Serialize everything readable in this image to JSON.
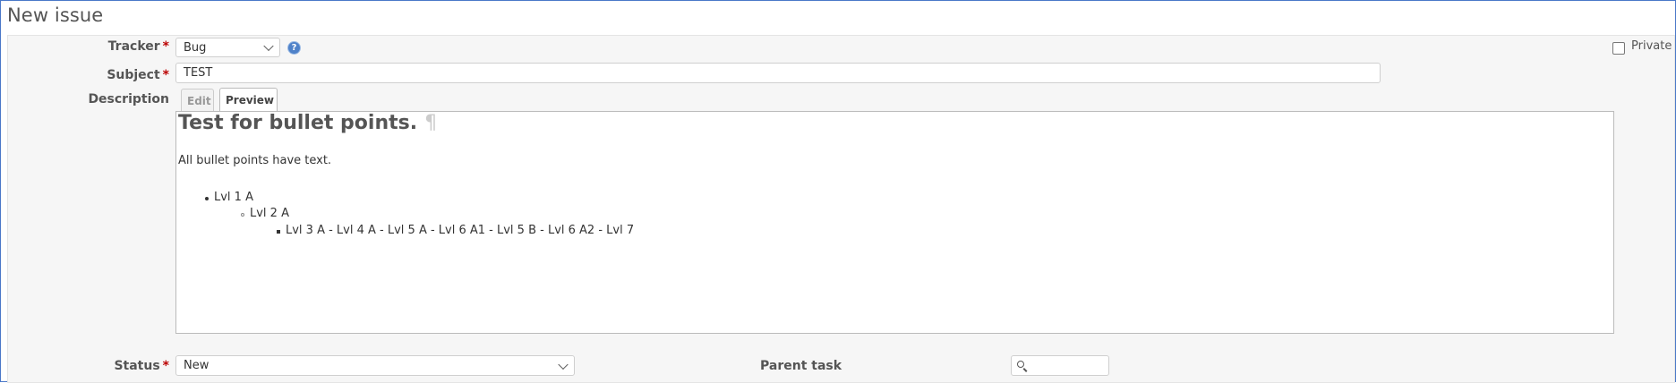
{
  "page": {
    "title": "New issue"
  },
  "tracker": {
    "label": "Tracker",
    "required": "*",
    "value": "Bug"
  },
  "private": {
    "label": "Private"
  },
  "subject": {
    "label": "Subject",
    "required": "*",
    "value": "TEST"
  },
  "description": {
    "label": "Description",
    "tabs": {
      "edit": "Edit",
      "preview": "Preview"
    },
    "preview": {
      "heading": "Test for bullet points.",
      "pilcrow": "¶",
      "paragraph": "All bullet points have text.",
      "list": [
        "Lvl 1 A",
        "Lvl 2 A",
        "Lvl 3 A - Lvl 4 A - Lvl 5 A - Lvl 6 A1 - Lvl 5 B - Lvl 6 A2 - Lvl 7"
      ]
    }
  },
  "status": {
    "label": "Status",
    "required": "*",
    "value": "New"
  },
  "parent_task": {
    "label": "Parent task",
    "value": ""
  },
  "icons": {
    "help": "help-icon",
    "parent_search": "search-icon"
  }
}
